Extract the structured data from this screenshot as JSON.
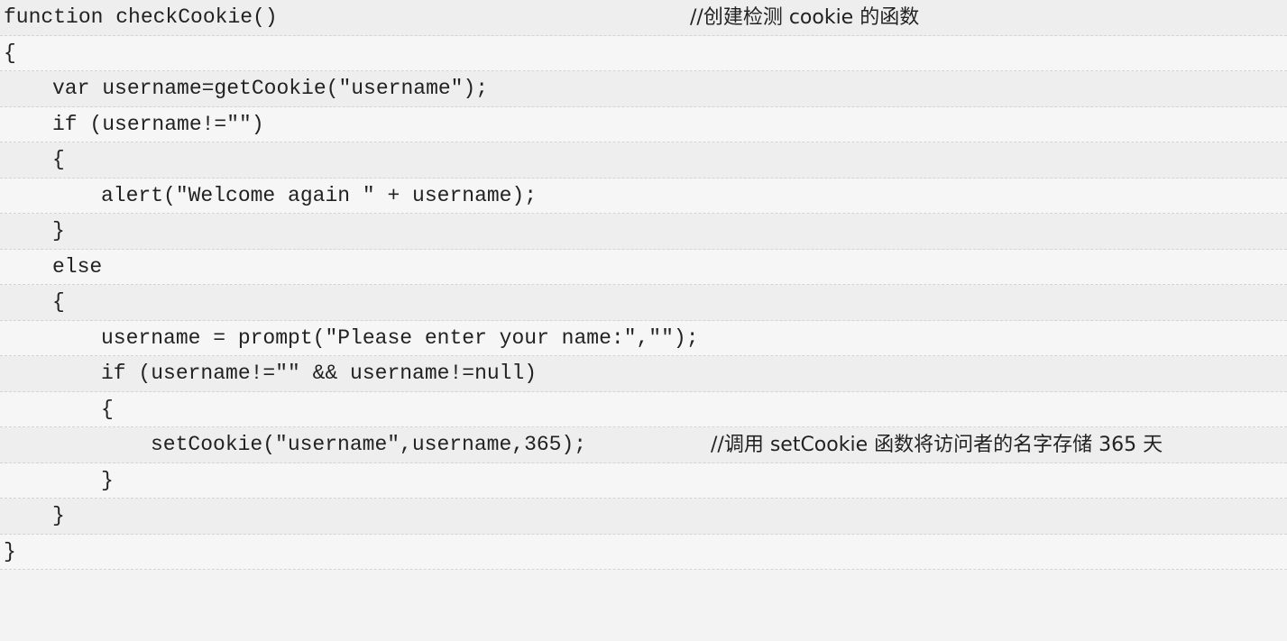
{
  "lines": [
    {
      "code": "function checkCookie()",
      "comment": "//创建检测 cookie 的函数"
    },
    {
      "code": "{"
    },
    {
      "code": "var username=getCookie(\"username\");"
    },
    {
      "code": "if (username!=\"\")"
    },
    {
      "code": "{"
    },
    {
      "code": "alert(\"Welcome again \" + username);"
    },
    {
      "code": "}"
    },
    {
      "code": "else"
    },
    {
      "code": "{"
    },
    {
      "code": "username = prompt(\"Please enter your name:\",\"\");"
    },
    {
      "code": "if (username!=\"\" && username!=null)"
    },
    {
      "code": "{"
    },
    {
      "code": "setCookie(\"username\",username,365);",
      "comment": "//调用 setCookie 函数将访问者的名字存储 365 天"
    },
    {
      "code": "}"
    },
    {
      "code": "}"
    },
    {
      "code": "}"
    }
  ]
}
